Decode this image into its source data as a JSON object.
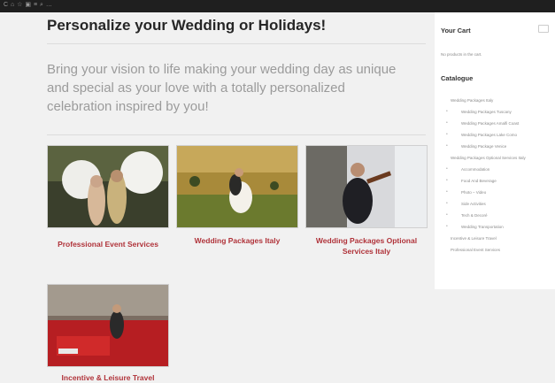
{
  "browser": {
    "crumbs": "C ⌂ ☆ ▣ ≡ ⌕ …"
  },
  "page": {
    "title": "Personalize your Wedding or Holidays!",
    "tagline": "Bring your vision to life making your wedding day as unique and special as your love with a totally personalized celebration inspired by you!"
  },
  "cards": [
    {
      "label": "Professional Event Services"
    },
    {
      "label": "Wedding Packages Italy"
    },
    {
      "label": "Wedding Packages Optional Services Italy"
    },
    {
      "label": "Incentive & Leisure Travel"
    }
  ],
  "sidebar": {
    "cart_title": "Your Cart",
    "cart_empty": "No products in the cart.",
    "catalogue_title": "Catalogue",
    "items": [
      {
        "label": "Wedding Packages Italy",
        "sub": false
      },
      {
        "label": "Wedding Packages Tuscany",
        "sub": true
      },
      {
        "label": "Wedding Packages Amalfi Coast",
        "sub": true
      },
      {
        "label": "Wedding Packages Lake Como",
        "sub": true
      },
      {
        "label": "Wedding Package Venice",
        "sub": true
      },
      {
        "label": "Wedding Packages Optional Services Italy",
        "sub": false
      },
      {
        "label": "Accommodation",
        "sub": true
      },
      {
        "label": "Food And Beverage",
        "sub": true
      },
      {
        "label": "Photo – Video",
        "sub": true
      },
      {
        "label": "Side Activities",
        "sub": true
      },
      {
        "label": "Tech & Decoré",
        "sub": true
      },
      {
        "label": "Wedding Transportation",
        "sub": true
      },
      {
        "label": "Incentive & Leisure Travel",
        "sub": false
      },
      {
        "label": "Professional Event Services",
        "sub": false
      }
    ]
  },
  "colors": {
    "accent": "#b0333a",
    "background": "#f1f1f1",
    "sidebar": "#ffffff",
    "topbar": "#1f1f1f"
  }
}
